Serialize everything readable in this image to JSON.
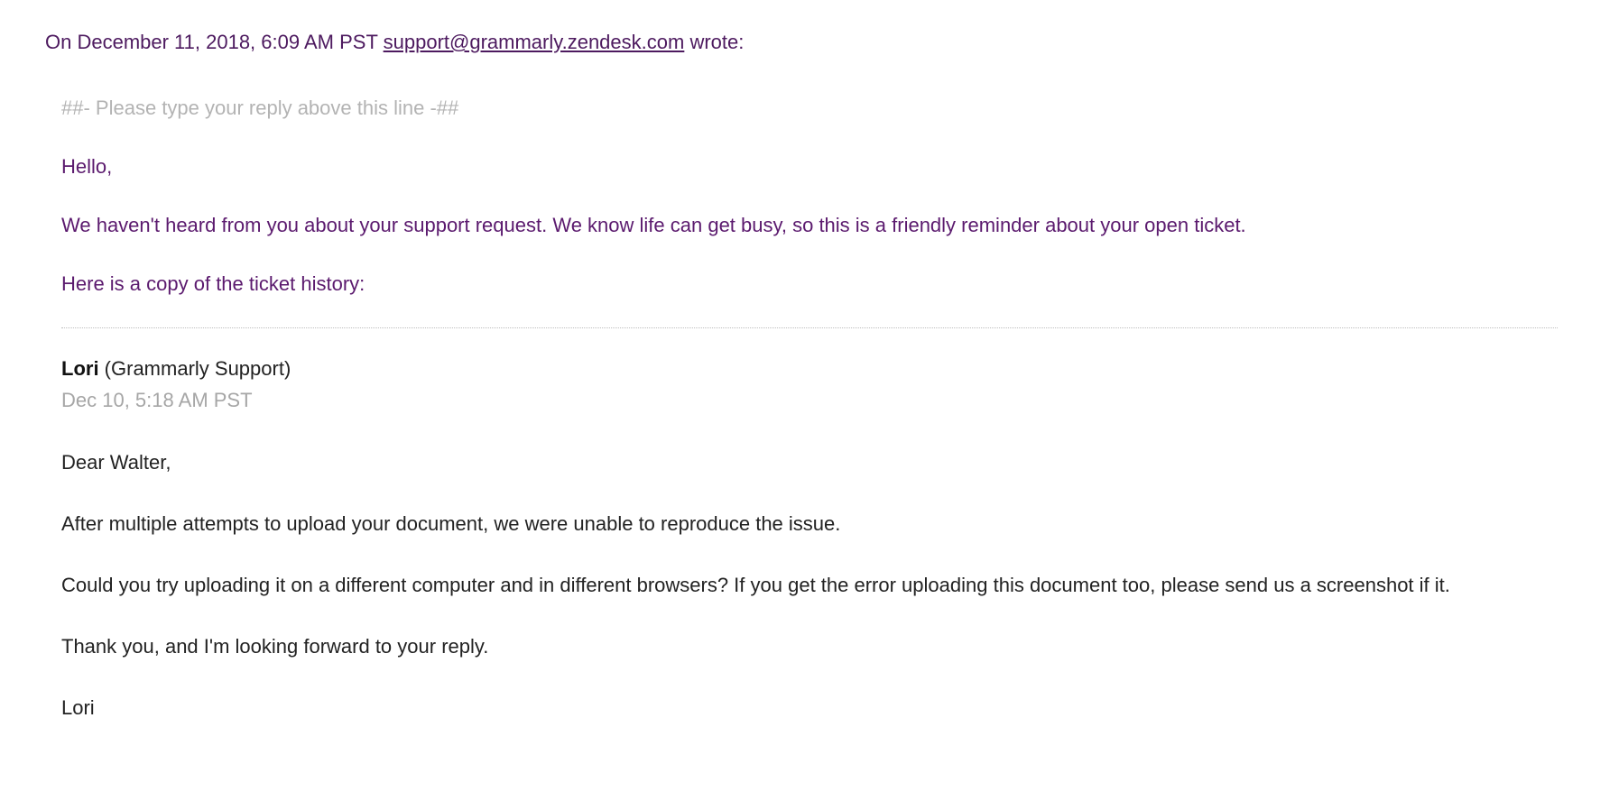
{
  "header": {
    "prefix": "On December 11, 2018, 6:09 AM PST ",
    "email": "support@grammarly.zendesk.com",
    "suffix": " wrote:"
  },
  "replyMarker": "##- Please type your reply above this line -##",
  "intro": {
    "greeting": "Hello,",
    "reminder": "We haven't heard from you about your support request. We know life can get busy, so this is a friendly reminder about your open ticket.",
    "historyIntro": "Here is a copy of the ticket history:"
  },
  "ticket": {
    "authorName": "Lori",
    "authorOrg": " (Grammarly Support)",
    "authorTime": "Dec 10, 5:18 AM PST",
    "body": {
      "greeting": "Dear Walter,",
      "p1": "After multiple attempts to upload your document, we were unable to reproduce the issue.",
      "p2": "Could you try uploading it on a different computer and in different browsers? If you get the error uploading this document too, please send us a screenshot if it.",
      "p3": "Thank you, and I'm looking forward to your reply.",
      "signoff": "Lori"
    }
  }
}
